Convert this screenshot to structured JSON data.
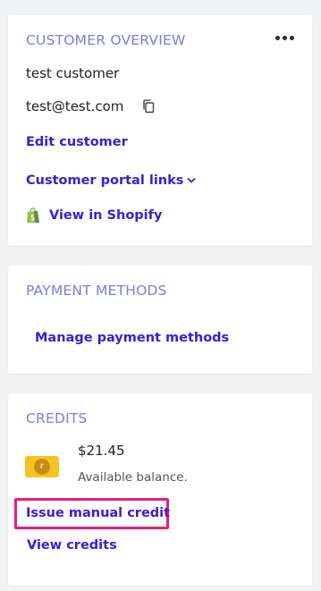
{
  "customer_overview": {
    "title": "CUSTOMER OVERVIEW",
    "name": "test customer",
    "email": "test@test.com",
    "edit_link": "Edit customer",
    "portal_links_label": "Customer portal links",
    "shopify_link": "View in Shopify",
    "menu_icon": "more-horizontal-icon",
    "copy_icon": "copy-icon",
    "shopify_icon": "shopify-bag-icon"
  },
  "payment_methods": {
    "title": "PAYMENT METHODS",
    "manage_link": "Manage payment methods"
  },
  "credits": {
    "title": "CREDITS",
    "balance": "$21.45",
    "balance_caption": "Available balance.",
    "issue_link": "Issue manual credit",
    "view_link": "View credits",
    "coin_icon": "credit-coin-icon"
  },
  "colors": {
    "accent": "#3d1ad8",
    "section_title": "#7b7fd6",
    "highlight": "#e91e78"
  }
}
